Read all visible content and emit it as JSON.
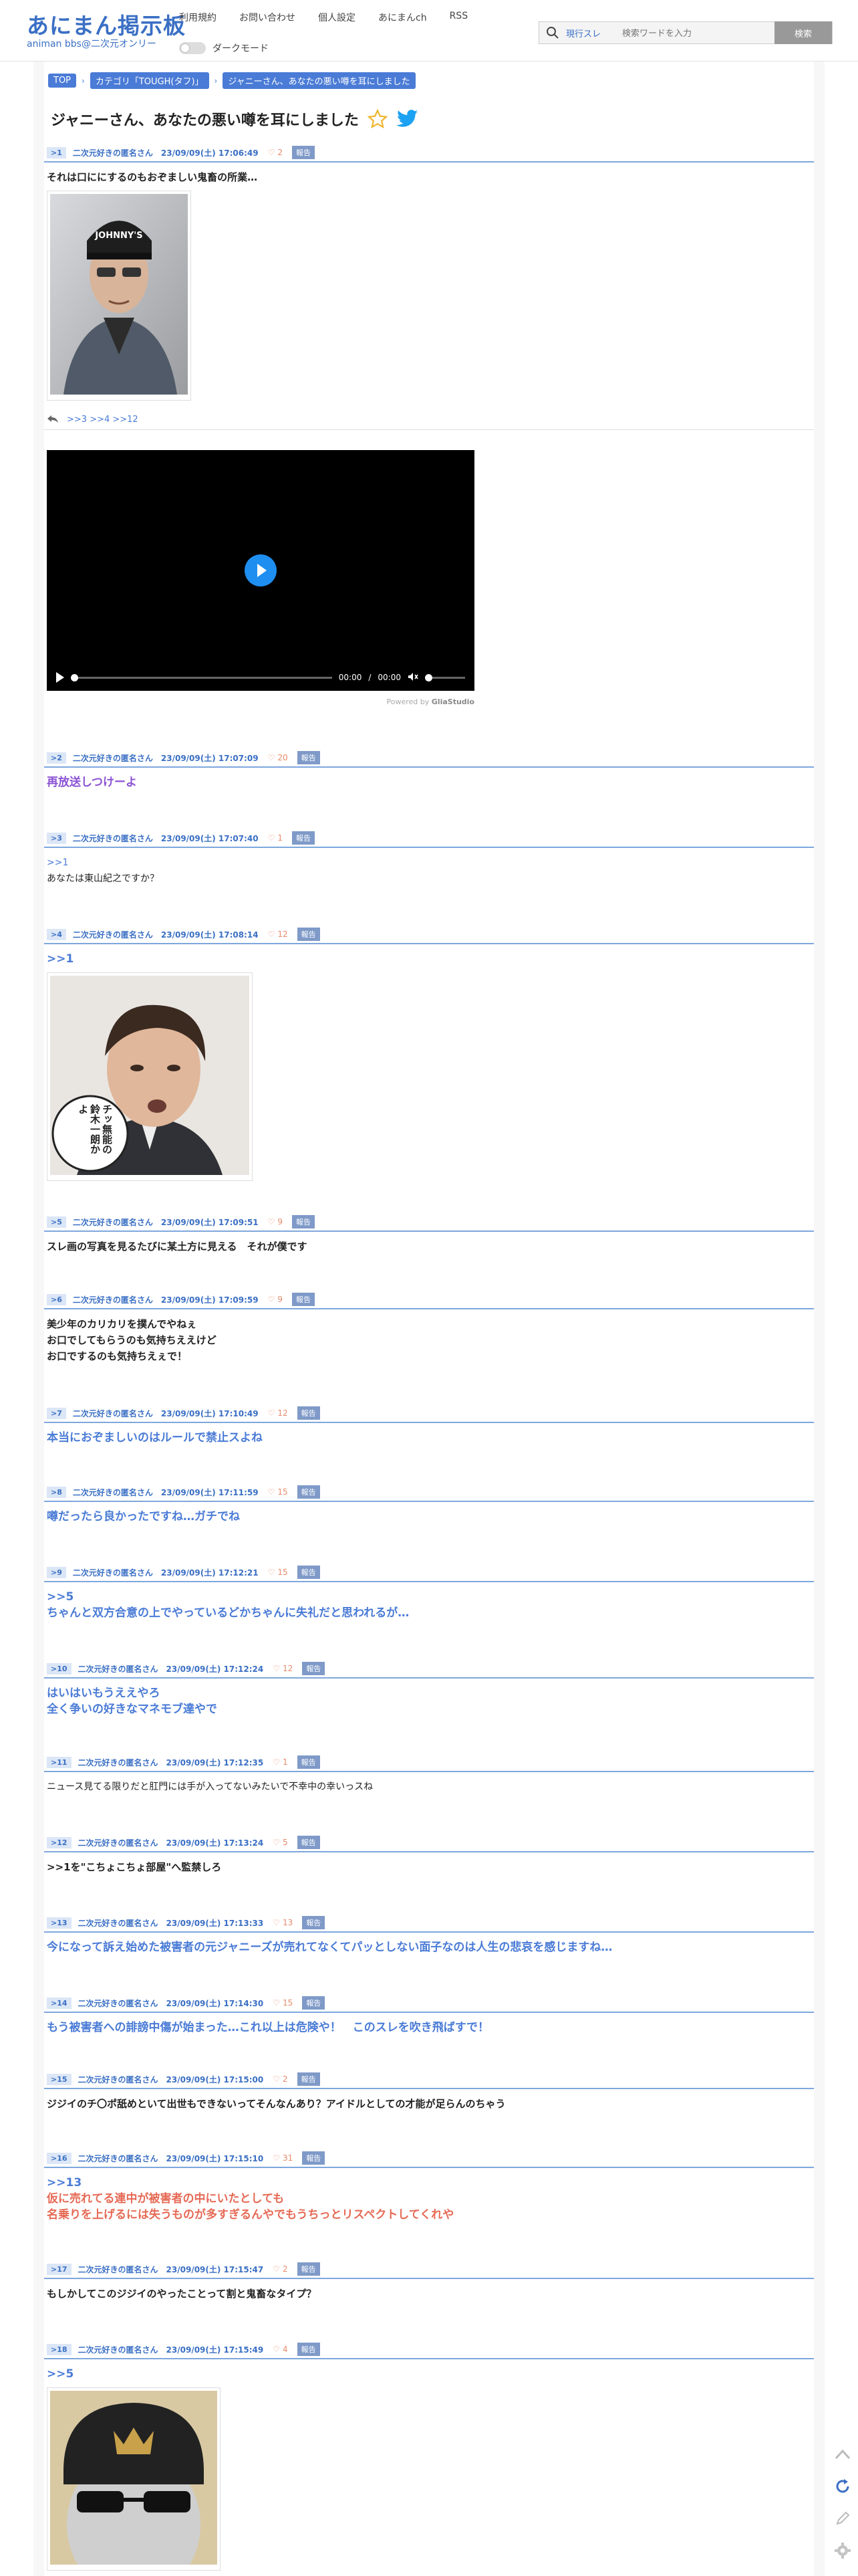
{
  "header": {
    "logo_main": "あにまん掲示板",
    "logo_sub": "animan bbs@二次元オンリー",
    "nav": [
      "利用規約",
      "お問い合わせ",
      "個人設定",
      "あにまんch",
      "RSS"
    ],
    "dark_mode_label": "ダークモード",
    "search_scope": "現行スレ",
    "search_placeholder": "検索ワードを入力",
    "search_button": "検索"
  },
  "breadcrumb": [
    "TOP",
    "カテゴリ「TOUGH(タフ)」",
    "ジャニーさん、あなたの悪い噂を耳にしました"
  ],
  "thread_title": "ジャニーさん、あなたの悪い噂を耳にしました",
  "reply_links": ">>3 >>4 >>12",
  "video": {
    "time_current": "00:00",
    "time_sep": "/",
    "time_total": "00:00",
    "powered_prefix": "Powered by",
    "powered_brand": "GliaStudio"
  },
  "posts": [
    {
      "num": "1",
      "name": "二次元好きの匿名さん",
      "date": "23/09/09(土) 17:06:49",
      "likes": "2",
      "report": "報告",
      "anchor": "",
      "lines": [
        "それは口ににするのもおぞましい鬼畜の所業…"
      ]
    },
    {
      "num": "2",
      "name": "二次元好きの匿名さん",
      "date": "23/09/09(土) 17:07:09",
      "likes": "20",
      "report": "報告",
      "anchor": "",
      "lines": [
        "再放送しつけーよ"
      ]
    },
    {
      "num": "3",
      "name": "二次元好きの匿名さん",
      "date": "23/09/09(土) 17:07:40",
      "likes": "1",
      "report": "報告",
      "anchor": ">>1",
      "lines": [
        "あなたは東山紀之ですか？"
      ]
    },
    {
      "num": "4",
      "name": "二次元好きの匿名さん",
      "date": "23/09/09(土) 17:08:14",
      "likes": "12",
      "report": "報告",
      "anchor": ">>1",
      "lines": [],
      "image_caption": "チッ無能の鈴木一朗かよ"
    },
    {
      "num": "5",
      "name": "二次元好きの匿名さん",
      "date": "23/09/09(土) 17:09:51",
      "likes": "9",
      "report": "報告",
      "anchor": "",
      "lines": [
        "スレ画の写真を見るたびに某土方に見える　それが僕です"
      ]
    },
    {
      "num": "6",
      "name": "二次元好きの匿名さん",
      "date": "23/09/09(土) 17:09:59",
      "likes": "9",
      "report": "報告",
      "anchor": "",
      "lines": [
        "美少年のカリカリを撲んでやねぇ",
        "お口でしてもらうのも気持ちええけど",
        "お口でするのも気持ちえぇで！"
      ]
    },
    {
      "num": "7",
      "name": "二次元好きの匿名さん",
      "date": "23/09/09(土) 17:10:49",
      "likes": "12",
      "report": "報告",
      "anchor": "",
      "lines": [
        "本当におぞましいのはルールで禁止スよね"
      ]
    },
    {
      "num": "8",
      "name": "二次元好きの匿名さん",
      "date": "23/09/09(土) 17:11:59",
      "likes": "15",
      "report": "報告",
      "anchor": "",
      "lines": [
        "噂だったら良かったですね…ガチでね"
      ]
    },
    {
      "num": "9",
      "name": "二次元好きの匿名さん",
      "date": "23/09/09(土) 17:12:21",
      "likes": "15",
      "report": "報告",
      "anchor": ">>5",
      "lines": [
        "ちゃんと双方合意の上でやっているどかちゃんに失礼だと思われるが…"
      ]
    },
    {
      "num": "10",
      "name": "二次元好きの匿名さん",
      "date": "23/09/09(土) 17:12:24",
      "likes": "12",
      "report": "報告",
      "anchor": "",
      "lines": [
        "はいはいもうええやろ",
        "全く争いの好きなマネモブ達やで"
      ]
    },
    {
      "num": "11",
      "name": "二次元好きの匿名さん",
      "date": "23/09/09(土) 17:12:35",
      "likes": "1",
      "report": "報告",
      "anchor": "",
      "lines": [
        "ニュース見てる限りだと肛門には手が入ってないみたいで不幸中の幸いっスね"
      ]
    },
    {
      "num": "12",
      "name": "二次元好きの匿名さん",
      "date": "23/09/09(土) 17:13:24",
      "likes": "5",
      "report": "報告",
      "anchor": "",
      "lines": [
        ">>1を\"こちょこちょ部屋\"へ監禁しろ"
      ]
    },
    {
      "num": "13",
      "name": "二次元好きの匿名さん",
      "date": "23/09/09(土) 17:13:33",
      "likes": "13",
      "report": "報告",
      "anchor": "",
      "lines": [
        "今になって訴え始めた被害者の元ジャニーズが売れてなくてパッとしない面子なのは人生の悲哀を感じますね…"
      ]
    },
    {
      "num": "14",
      "name": "二次元好きの匿名さん",
      "date": "23/09/09(土) 17:14:30",
      "likes": "15",
      "report": "報告",
      "anchor": "",
      "lines": [
        "もう被害者への誹謗中傷が始まった…これ以上は危険や！　このスレを吹き飛ばすで！"
      ]
    },
    {
      "num": "15",
      "name": "二次元好きの匿名さん",
      "date": "23/09/09(土) 17:15:00",
      "likes": "2",
      "report": "報告",
      "anchor": "",
      "lines": [
        "ジジイのチ〇ポ舐めといて出世もできないってそんなんあり？アイドルとしての才能が足らんのちゃう"
      ]
    },
    {
      "num": "16",
      "name": "二次元好きの匿名さん",
      "date": "23/09/09(土) 17:15:10",
      "likes": "31",
      "report": "報告",
      "anchor": ">>13",
      "lines": [
        "仮に売れてる連中が被害者の中にいたとしても",
        "名乗りを上げるには失うものが多すぎるんやでもうちっとリスペクトしてくれや"
      ]
    },
    {
      "num": "17",
      "name": "二次元好きの匿名さん",
      "date": "23/09/09(土) 17:15:47",
      "likes": "2",
      "report": "報告",
      "anchor": "",
      "lines": [
        "もしかしてこのジジイのやったことって割と鬼畜なタイプ？"
      ]
    },
    {
      "num": "18",
      "name": "二次元好きの匿名さん",
      "date": "23/09/09(土) 17:15:49",
      "likes": "4",
      "report": "報告",
      "anchor": ">>5",
      "lines": []
    }
  ],
  "colors": {
    "accent": "#3a6fc4",
    "purple": "#8b52d4",
    "red": "#e66a55",
    "likes": "#e88a6a"
  }
}
